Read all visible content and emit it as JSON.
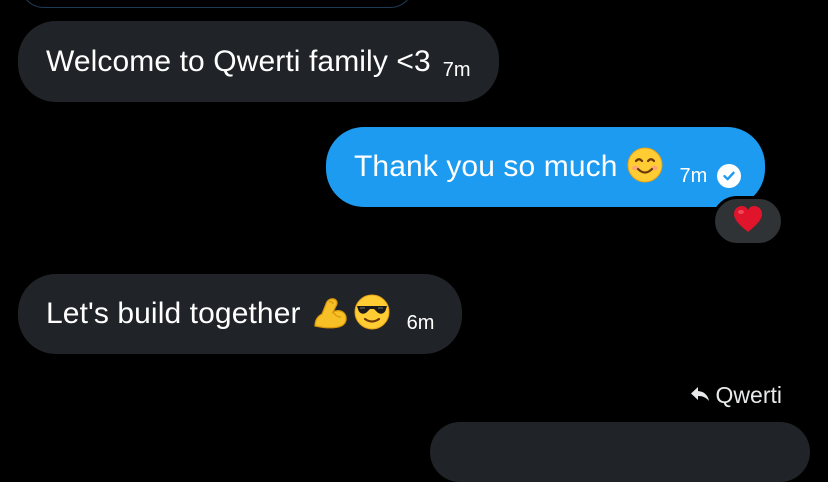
{
  "colors": {
    "background": "#000000",
    "received_bubble": "#202327",
    "sent_bubble": "#1d9bf0",
    "reaction_bg": "#2f3336"
  },
  "messages": [
    {
      "direction": "received",
      "text": "Welcome to Qwerti family <3",
      "time": "7m"
    },
    {
      "direction": "sent",
      "text": "Thank you so much",
      "emoji": "smiling-face-icon",
      "time": "7m",
      "status": "read-check-icon",
      "reaction": "red-heart-icon"
    },
    {
      "direction": "received",
      "text": "Let's build together",
      "emoji": [
        "flexed-biceps-icon",
        "sunglasses-face-icon"
      ],
      "time": "6m"
    }
  ],
  "reply": {
    "icon": "reply-arrow-icon",
    "label": "Qwerti"
  }
}
